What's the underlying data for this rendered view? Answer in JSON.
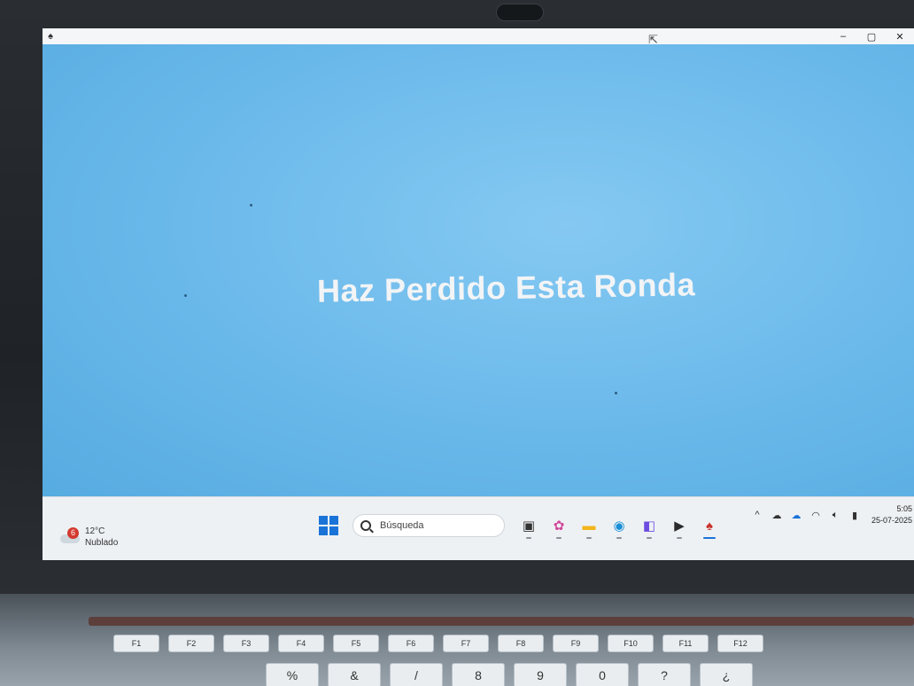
{
  "window": {
    "app_icon": "game-app-icon",
    "controls": {
      "minimize": "–",
      "maximize": "▢",
      "close": "✕"
    }
  },
  "game": {
    "message": "Haz Perdido Esta Ronda"
  },
  "taskbar": {
    "weather": {
      "badge": "6",
      "temperature": "12°C",
      "condition": "Nublado"
    },
    "search_placeholder": "Búsqueda",
    "apps": [
      {
        "name": "task-view-icon",
        "glyph": "▣",
        "color": "#333333"
      },
      {
        "name": "copilot-icon",
        "glyph": "✿",
        "color": "#d1479a"
      },
      {
        "name": "file-explorer-icon",
        "glyph": "▬",
        "color": "#f2b51c"
      },
      {
        "name": "edge-icon",
        "glyph": "◉",
        "color": "#1a8fd6"
      },
      {
        "name": "jetbrains-icon",
        "glyph": "◧",
        "color": "#6b4be0"
      },
      {
        "name": "terminal-icon",
        "glyph": "▶",
        "color": "#2b2b2b"
      },
      {
        "name": "game-app-icon",
        "glyph": "♠",
        "color": "#c8322a"
      }
    ],
    "tray": {
      "chevron": "^",
      "time": "5:05",
      "date": "25-07-2025"
    }
  },
  "keyboard": {
    "fkeys": [
      "F1",
      "F2",
      "F3",
      "F4",
      "F5",
      "F6",
      "F7",
      "F8",
      "F9",
      "F10",
      "F11",
      "F12"
    ],
    "numkeys": [
      "%",
      "&",
      "/",
      "8",
      "9",
      "0",
      "?",
      "¿"
    ]
  },
  "colors": {
    "game_background": "#64b4e8",
    "message_text": "#f2f4f6",
    "taskbar": "#eef1f4",
    "accent": "#1a74d8"
  }
}
